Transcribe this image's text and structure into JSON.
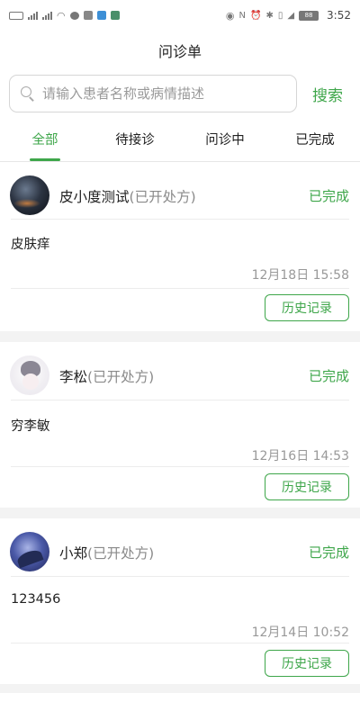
{
  "status_bar": {
    "time": "3:52",
    "battery": "88"
  },
  "header": {
    "title": "问诊单"
  },
  "search": {
    "placeholder": "请输入患者名称或病情描述",
    "value": "",
    "button_label": "搜索"
  },
  "tabs": [
    {
      "label": "全部",
      "active": true
    },
    {
      "label": "待接诊",
      "active": false
    },
    {
      "label": "问诊中",
      "active": false
    },
    {
      "label": "已完成",
      "active": false
    }
  ],
  "consultations": [
    {
      "name": "皮小度测试",
      "prescription": "(已开处方)",
      "status": "已完成",
      "description": "皮肤痒",
      "time": "12月18日 15:58",
      "history_label": "历史记录"
    },
    {
      "name": "李松",
      "prescription": "(已开处方)",
      "status": "已完成",
      "description": "穷李敏",
      "time": "12月16日 14:53",
      "history_label": "历史记录"
    },
    {
      "name": "小郑",
      "prescription": "(已开处方)",
      "status": "已完成",
      "description": "123456",
      "time": "12月14日 10:52",
      "history_label": "历史记录"
    }
  ],
  "colors": {
    "accent": "#3ea64a",
    "muted": "#999999"
  }
}
